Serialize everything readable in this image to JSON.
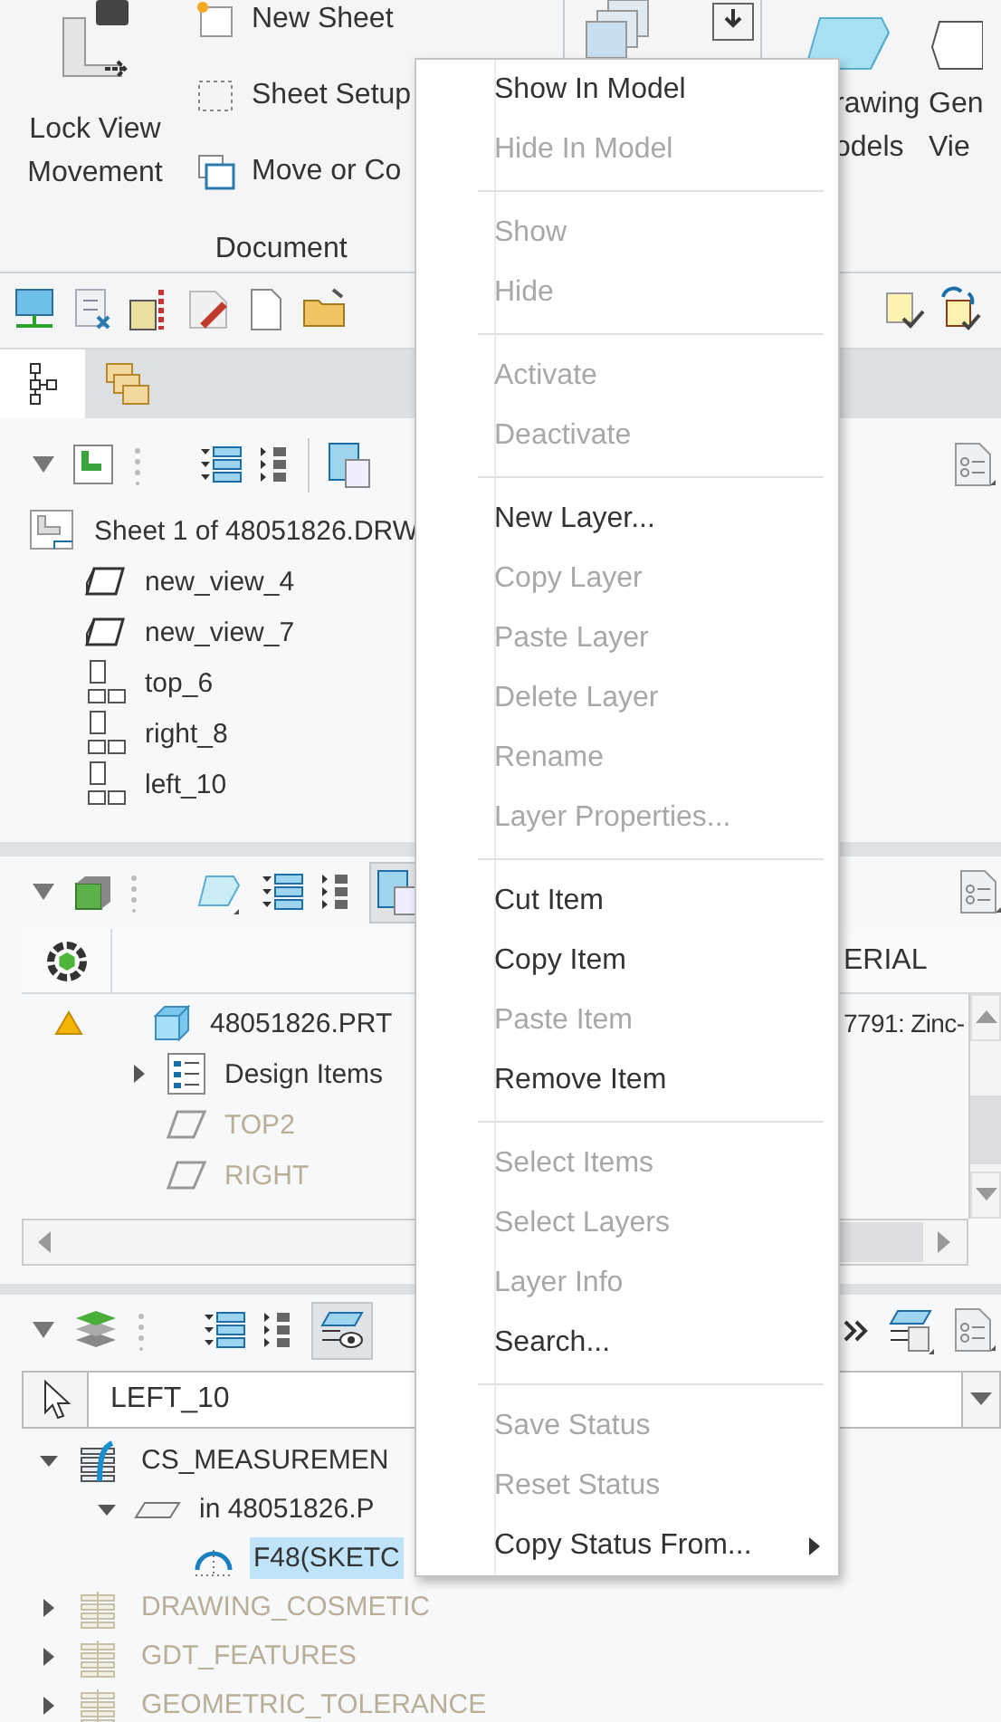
{
  "ribbon": {
    "lock_view": {
      "label": "Lock View Movement"
    },
    "document_group": {
      "title": "Document",
      "items": [
        {
          "label": "New Sheet"
        },
        {
          "label": "Sheet Setup"
        },
        {
          "label": "Move or Co"
        }
      ]
    },
    "model_buttons": [
      {
        "lines": [
          "rawing",
          "odels"
        ]
      },
      {
        "lines": [
          "Gen",
          "Vie"
        ]
      }
    ]
  },
  "navigator_tabs": [
    {
      "kind": "tree",
      "selected": true
    },
    {
      "kind": "folders",
      "selected": false
    }
  ],
  "drawing_tree": {
    "items": [
      {
        "label": "Sheet 1 of 48051826.DRW",
        "kind": "sheet",
        "children": [
          {
            "label": "new_view_4",
            "kind": "general_view"
          },
          {
            "label": "new_view_7",
            "kind": "general_view"
          },
          {
            "label": "top_6",
            "kind": "projection_view"
          },
          {
            "label": "right_8",
            "kind": "projection_view"
          },
          {
            "label": "left_10",
            "kind": "projection_view"
          }
        ]
      }
    ]
  },
  "model_tree": {
    "column_header": "ERIAL",
    "items": [
      {
        "label": "48051826.PRT",
        "kind": "part",
        "warning": true,
        "material": "7791: Zinc-",
        "children": [
          {
            "label": "Design Items",
            "kind": "design_items",
            "expanded": false
          },
          {
            "label": "TOP2",
            "kind": "datum_plane"
          },
          {
            "label": "RIGHT",
            "kind": "datum_plane"
          }
        ]
      }
    ]
  },
  "layer_tree": {
    "filter": {
      "value": "LEFT_10"
    },
    "items": [
      {
        "label": "CS_MEASUREMEN",
        "kind": "layer",
        "hidden": false,
        "expanded": true,
        "selected": false,
        "children": [
          {
            "label": "in 48051826.P",
            "kind": "model_ref",
            "hidden": false,
            "expanded": true,
            "selected": false,
            "children": [
              {
                "label": "F48(SKETC",
                "kind": "sketch",
                "hidden": false,
                "selected": true
              }
            ]
          }
        ]
      },
      {
        "label": "DRAWING_COSMETIC",
        "kind": "layer",
        "hidden": true,
        "expanded": false,
        "selected": false
      },
      {
        "label": "GDT_FEATURES",
        "kind": "layer",
        "hidden": true,
        "expanded": false,
        "selected": false
      },
      {
        "label": "GEOMETRIC_TOLERANCE",
        "kind": "layer",
        "hidden": true,
        "expanded": false,
        "selected": false
      }
    ]
  },
  "context_menu": {
    "sections": [
      [
        {
          "label": "Show In Model",
          "disabled": false,
          "submenu": false
        },
        {
          "label": "Hide In Model",
          "disabled": true,
          "submenu": false
        }
      ],
      [
        {
          "label": "Show",
          "disabled": true,
          "submenu": false
        },
        {
          "label": "Hide",
          "disabled": true,
          "submenu": false
        }
      ],
      [
        {
          "label": "Activate",
          "disabled": true,
          "submenu": false
        },
        {
          "label": "Deactivate",
          "disabled": true,
          "submenu": false
        }
      ],
      [
        {
          "label": "New Layer...",
          "disabled": false,
          "submenu": false
        },
        {
          "label": "Copy Layer",
          "disabled": true,
          "submenu": false
        },
        {
          "label": "Paste Layer",
          "disabled": true,
          "submenu": false
        },
        {
          "label": "Delete Layer",
          "disabled": true,
          "submenu": false
        },
        {
          "label": "Rename",
          "disabled": true,
          "submenu": false
        },
        {
          "label": "Layer Properties...",
          "disabled": true,
          "submenu": false
        }
      ],
      [
        {
          "label": "Cut Item",
          "disabled": false,
          "submenu": false
        },
        {
          "label": "Copy Item",
          "disabled": false,
          "submenu": false
        },
        {
          "label": "Paste Item",
          "disabled": true,
          "submenu": false
        },
        {
          "label": "Remove Item",
          "disabled": false,
          "submenu": false
        }
      ],
      [
        {
          "label": "Select Items",
          "disabled": true,
          "submenu": false
        },
        {
          "label": "Select Layers",
          "disabled": true,
          "submenu": false
        },
        {
          "label": "Layer Info",
          "disabled": true,
          "submenu": false
        },
        {
          "label": "Search...",
          "disabled": false,
          "submenu": false
        }
      ],
      [
        {
          "label": "Save Status",
          "disabled": true,
          "submenu": false
        },
        {
          "label": "Reset Status",
          "disabled": true,
          "submenu": false
        },
        {
          "label": "Copy Status From...",
          "disabled": false,
          "submenu": true
        }
      ]
    ]
  }
}
